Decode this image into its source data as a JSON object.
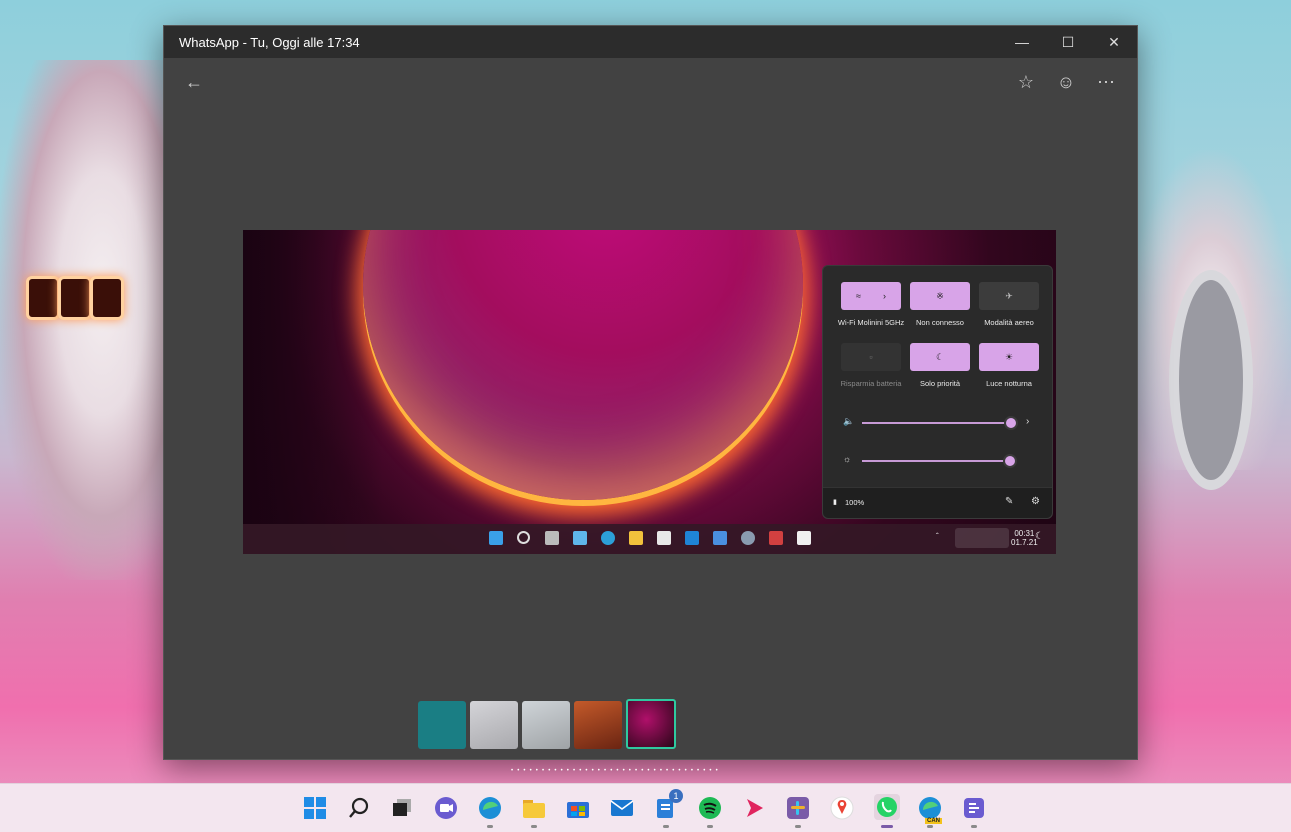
{
  "window": {
    "title": "WhatsApp - Tu, Oggi alle 17:34"
  },
  "toolbar": {
    "back_icon": "arrow-left-icon",
    "star_icon": "star-icon",
    "emoji_icon": "smiley-icon",
    "more_icon": "more-icon"
  },
  "photo": {
    "quick_settings": {
      "tiles": [
        {
          "label": "Wi-Fi Molinini 5GHz",
          "icon": "wifi-icon",
          "state": "on"
        },
        {
          "label": "Non connesso",
          "icon": "bluetooth-icon",
          "state": "on"
        },
        {
          "label": "Modalità aereo",
          "icon": "airplane-icon",
          "state": "off"
        },
        {
          "label": "Risparmia batteria",
          "icon": "battery-saver-icon",
          "state": "disabled"
        },
        {
          "label": "Solo priorità",
          "icon": "moon-icon",
          "state": "on"
        },
        {
          "label": "Luce notturna",
          "icon": "night-light-icon",
          "state": "on"
        }
      ],
      "volume_level": 0.95,
      "brightness_level": 0.95,
      "battery": "100%"
    },
    "taskbar": {
      "time": "00:31",
      "date": "01.7.21"
    }
  },
  "thumbnails": [
    "teal",
    "start-menu",
    "start-menu-2",
    "orange-wallpaper",
    "current"
  ],
  "accent": "#d8a4e8",
  "taskbar": {
    "apps": [
      "windows-start-icon",
      "search-icon",
      "task-view-icon",
      "teams-chat-icon",
      "edge-icon",
      "file-explorer-icon",
      "store-icon",
      "mail-icon",
      "notes-icon",
      "spotify-icon",
      "play-icon",
      "slack-icon",
      "maps-icon",
      "whatsapp-icon",
      "edge-canary-icon",
      "feedback-icon"
    ],
    "notes_badge": "1",
    "edge_canary_badge": "CAN"
  }
}
